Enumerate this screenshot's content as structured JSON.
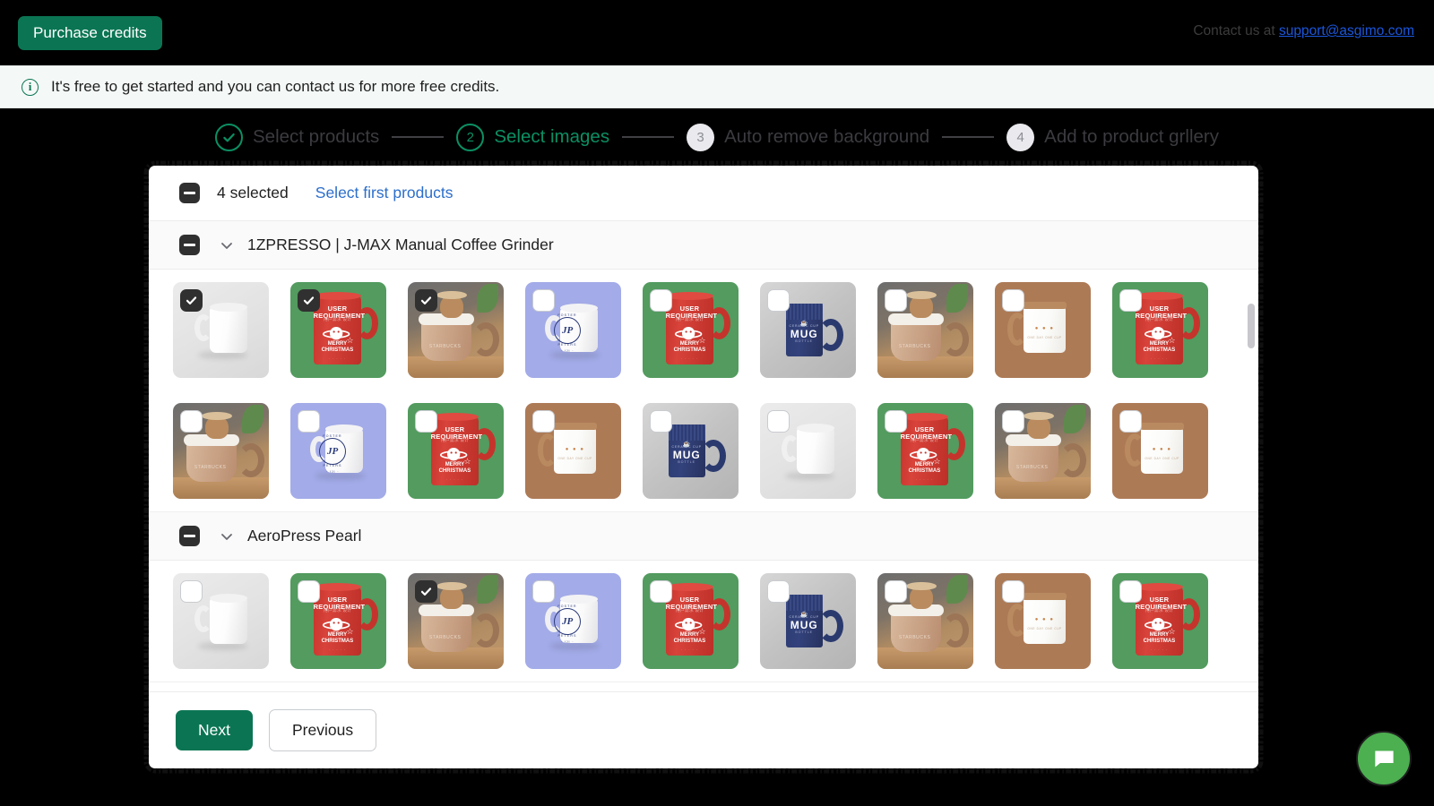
{
  "topbar": {
    "purchase_label": "Purchase credits",
    "contact_prefix": "Contact us at ",
    "contact_email": "support@asgimo.com"
  },
  "banner": {
    "icon": "info-icon",
    "text": "It's free to get started and you can contact us for more free credits."
  },
  "stepper": {
    "steps": [
      {
        "number": "✓",
        "label": "Select products",
        "state": "done"
      },
      {
        "number": "2",
        "label": "Select images",
        "state": "current"
      },
      {
        "number": "3",
        "label": "Auto remove background",
        "state": "todo"
      },
      {
        "number": "4",
        "label": "Add to product grllery",
        "state": "todo"
      }
    ]
  },
  "modal": {
    "select_all": {
      "checkbox_state": "indeterminate",
      "count_label": "4 selected",
      "link_label": "Select first products"
    },
    "groups": [
      {
        "checkbox_state": "indeterminate",
        "title": "1ZPRESSO | J-MAX Manual Coffee Grinder",
        "chevron": "chevron-down-icon",
        "rows": [
          {
            "thumbs": [
              {
                "art": "white-mug-grey",
                "checked": true
              },
              {
                "art": "red-xmas-green",
                "checked": true
              },
              {
                "art": "bear-starbucks",
                "checked": true
              },
              {
                "art": "foster-peters",
                "checked": false
              },
              {
                "art": "red-xmas-green",
                "checked": false
              },
              {
                "art": "navy-mug",
                "checked": false
              },
              {
                "art": "bear-starbucks",
                "checked": false
              },
              {
                "art": "enamel-tan",
                "checked": false
              },
              {
                "art": "red-xmas-green",
                "checked": false
              }
            ]
          },
          {
            "thumbs": [
              {
                "art": "bear-starbucks",
                "checked": false
              },
              {
                "art": "foster-peters",
                "checked": false
              },
              {
                "art": "red-xmas-green",
                "checked": false
              },
              {
                "art": "enamel-tan",
                "checked": false
              },
              {
                "art": "navy-mug",
                "checked": false
              },
              {
                "art": "white-mug-grey",
                "checked": false
              },
              {
                "art": "red-xmas-green",
                "checked": false
              },
              {
                "art": "bear-starbucks",
                "checked": false
              },
              {
                "art": "enamel-tan",
                "checked": false
              }
            ]
          }
        ]
      },
      {
        "checkbox_state": "indeterminate",
        "title": "AeroPress Pearl",
        "chevron": "chevron-down-icon",
        "rows": [
          {
            "thumbs": [
              {
                "art": "white-mug-grey",
                "checked": false
              },
              {
                "art": "red-xmas-green",
                "checked": false
              },
              {
                "art": "bear-starbucks",
                "checked": true
              },
              {
                "art": "foster-peters",
                "checked": false
              },
              {
                "art": "red-xmas-green",
                "checked": false
              },
              {
                "art": "navy-mug",
                "checked": false
              },
              {
                "art": "bear-starbucks",
                "checked": false
              },
              {
                "art": "enamel-tan",
                "checked": false
              },
              {
                "art": "red-xmas-green",
                "checked": false
              }
            ]
          }
        ]
      }
    ],
    "footer": {
      "next_label": "Next",
      "previous_label": "Previous"
    }
  },
  "chat": {
    "icon": "chat-bubble-icon",
    "accent": "#4caf50"
  },
  "artwork_text": {
    "red_title_1": "USER",
    "red_title_2": "REQUIREMENT",
    "red_sub": "用户需求 设计",
    "red_low_1": "MERRY",
    "red_low_2": "CHRISTMAS",
    "red_foot": "· · · · ·",
    "sb_brand": "STARBUCKS",
    "fp_mono": "JP",
    "fp_arc_top": "FOSTER",
    "fp_arc_bottom": "PETERS",
    "fp_tiny": "· IJI ·",
    "navy_label": "MUG",
    "navy_sub": "CERAMIC CUP",
    "navy_foot": "BOTTLE",
    "en_dots": "● ● ●",
    "en_sub": "ONE DAY ONE CUP"
  },
  "colors": {
    "brand_green": "#0b7553",
    "step_green": "#0b8f63",
    "link_blue": "#2c6ecb",
    "contact_blue": "#1a56db",
    "checkbox_dark": "#303030"
  }
}
